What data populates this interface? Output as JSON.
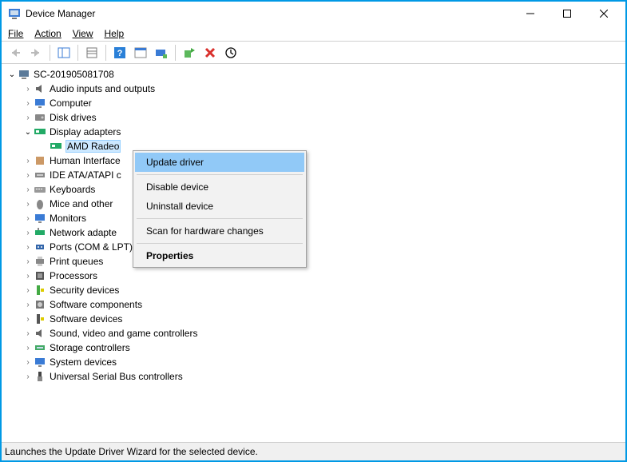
{
  "window": {
    "title": "Device Manager"
  },
  "menubar": {
    "file": "File",
    "action": "Action",
    "view": "View",
    "help": "Help"
  },
  "tree": {
    "root": "SC-201905081708",
    "nodes": {
      "audio": "Audio inputs and outputs",
      "computer": "Computer",
      "disk": "Disk drives",
      "display": "Display adapters",
      "display_child": "AMD Radeo",
      "hid": "Human Interface",
      "ide": "IDE ATA/ATAPI c",
      "keyboards": "Keyboards",
      "mice": "Mice and other",
      "monitors": "Monitors",
      "network": "Network adapte",
      "ports": "Ports (COM & LPT)",
      "printq": "Print queues",
      "processors": "Processors",
      "security": "Security devices",
      "swcomp": "Software components",
      "swdev": "Software devices",
      "sound": "Sound, video and game controllers",
      "storage": "Storage controllers",
      "system": "System devices",
      "usb": "Universal Serial Bus controllers"
    }
  },
  "context_menu": {
    "update": "Update driver",
    "disable": "Disable device",
    "uninstall": "Uninstall device",
    "scan": "Scan for hardware changes",
    "properties": "Properties"
  },
  "statusbar": {
    "text": "Launches the Update Driver Wizard for the selected device."
  }
}
